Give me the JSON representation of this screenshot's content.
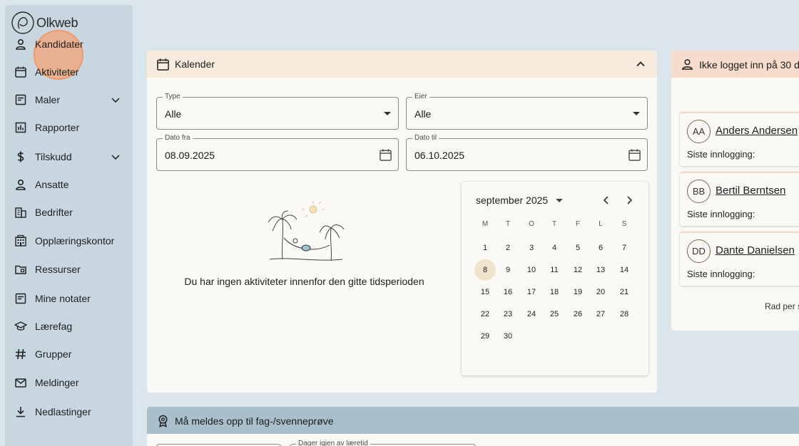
{
  "app": {
    "logo_text": "Olkweb"
  },
  "sidebar": {
    "items": [
      {
        "label": "Kandidater",
        "icon": "person-icon"
      },
      {
        "label": "Aktiviteter",
        "icon": "calendar-icon"
      },
      {
        "label": "Maler",
        "icon": "template-icon",
        "expandable": true
      },
      {
        "label": "Rapporter",
        "icon": "chart-icon"
      },
      {
        "label": "Tilskudd",
        "icon": "dollar-icon",
        "expandable": true
      },
      {
        "label": "Ansatte",
        "icon": "person-icon"
      },
      {
        "label": "Bedrifter",
        "icon": "building-icon"
      },
      {
        "label": "Opplæringskontor",
        "icon": "office-icon"
      },
      {
        "label": "Ressurser",
        "icon": "folder-icon"
      },
      {
        "label": "Mine notater",
        "icon": "note-icon"
      },
      {
        "label": "Lærefag",
        "icon": "graduation-icon"
      },
      {
        "label": "Grupper",
        "icon": "hash-icon"
      },
      {
        "label": "Meldinger",
        "icon": "mail-icon"
      },
      {
        "label": "Nedlastinger",
        "icon": "download-icon"
      }
    ]
  },
  "calendar": {
    "title": "Kalender",
    "type_label": "Type",
    "type_value": "Alle",
    "owner_label": "Eier",
    "owner_value": "Alle",
    "date_from_label": "Dato fra",
    "date_from_value": "08.09.2025",
    "date_to_label": "Dato til",
    "date_to_value": "06.10.2025",
    "empty_text": "Du har ingen aktiviteter innenfor den gitte tidsperioden"
  },
  "picker": {
    "month": "september 2025",
    "weekdays": [
      "M",
      "T",
      "O",
      "T",
      "F",
      "L",
      "S"
    ],
    "selected_day": 8,
    "days": [
      1,
      2,
      3,
      4,
      5,
      6,
      7,
      8,
      9,
      10,
      11,
      12,
      13,
      14,
      15,
      16,
      17,
      18,
      19,
      20,
      21,
      22,
      23,
      24,
      25,
      26,
      27,
      28,
      29,
      30
    ]
  },
  "inactive": {
    "title": "Ikke logget inn på 30 d",
    "people": [
      {
        "initials": "AA",
        "name": "Anders Andersen",
        "login_label": "Siste innlogging:"
      },
      {
        "initials": "BB",
        "name": "Bertil Berntsen",
        "login_label": "Siste innlogging:"
      },
      {
        "initials": "DD",
        "name": "Dante Danielsen",
        "login_label": "Siste innlogging:"
      }
    ],
    "rows_per_page": "Rad per s"
  },
  "exam": {
    "title": "Må meldes opp til fag-/svenneprøve",
    "days_left_label": "Dager igjen av læretid"
  }
}
